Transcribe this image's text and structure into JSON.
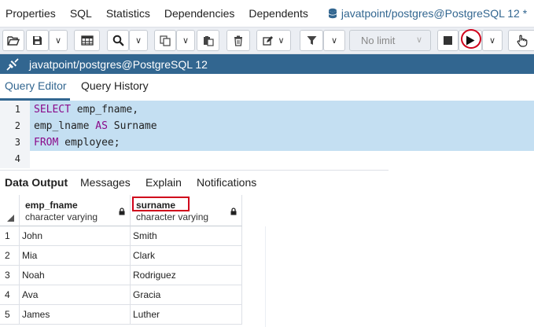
{
  "top_tabs": {
    "items": [
      "Properties",
      "SQL",
      "Statistics",
      "Dependencies",
      "Dependents"
    ],
    "active": "javatpoint/postgres@PostgreSQL 12 *"
  },
  "toolbar": {
    "limit_label": "No limit",
    "limit_arrow": "∨",
    "dropdown_glyph": "∨"
  },
  "connection": {
    "label": "javatpoint/postgres@PostgreSQL 12"
  },
  "editor_tabs": [
    "Query Editor",
    "Query History"
  ],
  "editor": {
    "line_numbers": [
      "1",
      "2",
      "3",
      "4"
    ],
    "lines": [
      {
        "kw": "SELECT",
        "rest": " emp_fname,"
      },
      {
        "pre": "emp_lname ",
        "kw": "AS",
        "rest": " Surname"
      },
      {
        "kw": "FROM",
        "rest": " employee;"
      }
    ]
  },
  "output_tabs": [
    "Data Output",
    "Messages",
    "Explain",
    "Notifications"
  ],
  "grid": {
    "columns": [
      {
        "name": "emp_fname",
        "type": "character varying"
      },
      {
        "name": "surname",
        "type": "character varying"
      }
    ],
    "rows": [
      {
        "num": "1",
        "fname": "John",
        "surname": "Smith"
      },
      {
        "num": "2",
        "fname": "Mia",
        "surname": "Clark"
      },
      {
        "num": "3",
        "fname": "Noah",
        "surname": "Rodriguez"
      },
      {
        "num": "4",
        "fname": "Ava",
        "surname": "Gracia"
      },
      {
        "num": "5",
        "fname": "James",
        "surname": "Luther"
      }
    ]
  },
  "colors": {
    "accent": "#326690",
    "keyword": "#8a0a8a",
    "selection": "#c4dff2",
    "highlight": "#d0021b"
  }
}
